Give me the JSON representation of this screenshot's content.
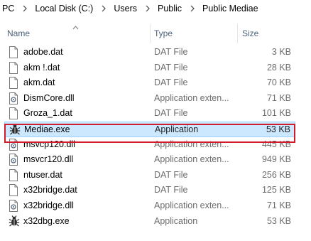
{
  "breadcrumb": [
    "PC",
    "Local Disk (C:)",
    "Users",
    "Public",
    "Public Mediae"
  ],
  "columns": {
    "name": "Name",
    "type": "Type",
    "size": "Size"
  },
  "files": [
    {
      "name": "adobe.dat",
      "type": "DAT File",
      "size": "3 KB",
      "icon": "file-icon"
    },
    {
      "name": "akm     !.dat",
      "type": "DAT File",
      "size": "28 KB",
      "icon": "file-icon"
    },
    {
      "name": "akm.dat",
      "type": "DAT File",
      "size": "70 KB",
      "icon": "file-icon"
    },
    {
      "name": "DismCore.dll",
      "type": "Application exten...",
      "size": "71 KB",
      "icon": "dll-icon"
    },
    {
      "name": "Groza_1.dat",
      "type": "DAT File",
      "size": "101 KB",
      "icon": "file-icon"
    },
    {
      "name": "Mediae.exe",
      "type": "Application",
      "size": "53 KB",
      "icon": "bug-app-icon",
      "selected": true
    },
    {
      "name": "msvcp120.dll",
      "type": "Application exten...",
      "size": "445 KB",
      "icon": "dll-icon"
    },
    {
      "name": "msvcr120.dll",
      "type": "Application exten...",
      "size": "949 KB",
      "icon": "dll-icon"
    },
    {
      "name": "ntuser.dat",
      "type": "DAT File",
      "size": "256 KB",
      "icon": "file-icon"
    },
    {
      "name": "x32bridge.dat",
      "type": "DAT File",
      "size": "125 KB",
      "icon": "file-icon"
    },
    {
      "name": "x32bridge.dll",
      "type": "Application exten...",
      "size": "71 KB",
      "icon": "dll-icon"
    },
    {
      "name": "x32dbg.exe",
      "type": "Application",
      "size": "53 KB",
      "icon": "bug-app-icon"
    }
  ],
  "colors": {
    "selection": "#cce8ff",
    "highlight_box": "#d11d2b"
  }
}
